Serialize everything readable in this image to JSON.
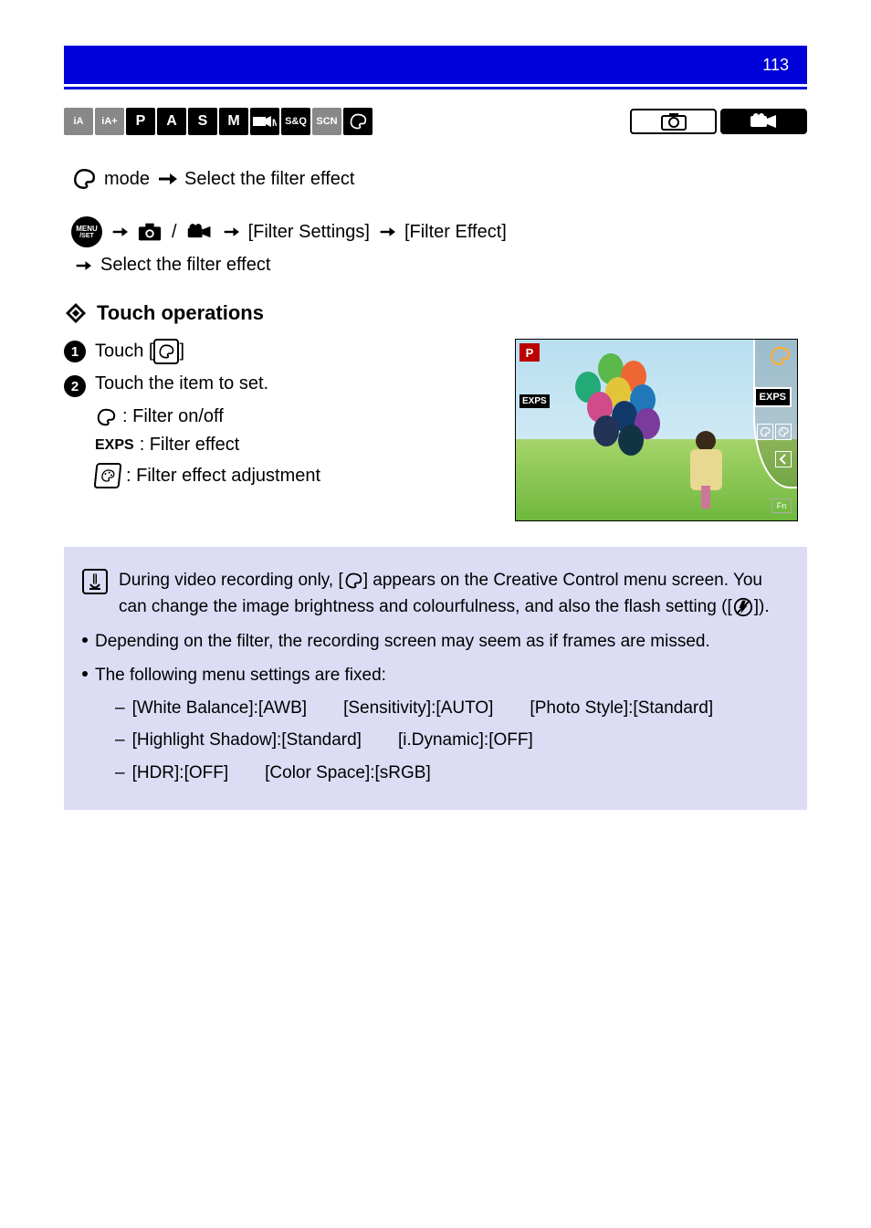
{
  "header": {
    "page_number": "113"
  },
  "modes": {
    "ia": "iA",
    "iap": "iA+",
    "p": "P",
    "a": "A",
    "s": "S",
    "m": "M",
    "mvm": "M",
    "sq": "S&Q",
    "scn": "SCN",
    "cc": "palette"
  },
  "rec": {
    "photo": "photo",
    "video": "video"
  },
  "path1": {
    "icon": "palette",
    "mode_label": "mode",
    "after": "Select the filter effect"
  },
  "path2": {
    "menu": "MENU/SET",
    "group": "[Filter Settings]",
    "item": "[Filter Effect]",
    "after": "Select the filter effect"
  },
  "touch": {
    "heading": "Touch operations",
    "step1_pre": "Touch [",
    "step1_post": "]",
    "step2": "Touch the item to set.",
    "item_a": ": Filter on/off",
    "item_b": ": Filter effect",
    "item_c": ": Filter effect adjustment",
    "item_b_label": "EXPS"
  },
  "screenshot": {
    "p": "P",
    "exps": "EXPS",
    "fn": "Fn"
  },
  "note": {
    "line1_a": "During video recording only, [",
    "line1_b": "] appears on the Creative Control menu screen. You can change the image brightness and colourfulness, and also the flash setting ([",
    "line1_c": "]).",
    "bullet": "Depending on the filter, the recording screen may seem as if frames are missed.",
    "sub_head": "The following menu settings are fixed:",
    "sub1_a": "[White Balance]:[AWB]",
    "sub1_b": "[Sensitivity]:[AUTO]",
    "sub1_c": "[Photo Style]:[Standard]",
    "sub2_a": "[Highlight Shadow]:[Standard]",
    "sub2_b": "[i.Dynamic]:[OFF]",
    "sub3_a": "[HDR]:[OFF]",
    "sub3_b": "[Color Space]:[sRGB]"
  }
}
